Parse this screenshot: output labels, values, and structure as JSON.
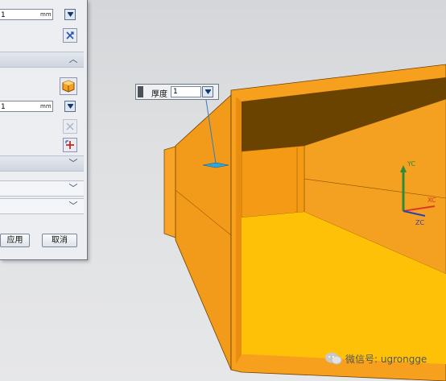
{
  "dialog": {
    "value1": "1",
    "unit1": "mm",
    "value2": "1",
    "unit2": "mm",
    "apply_label": "应用",
    "cancel_label": "取消"
  },
  "thickness_handle": {
    "label": "厚度",
    "value": "1"
  },
  "axes": {
    "y_label": "YC",
    "x_label": "XC",
    "z_label": "ZC"
  },
  "watermark": {
    "text": "微信号: ugrongge"
  },
  "colors": {
    "model_orange": "#f39a1c",
    "model_dark": "#6b4300",
    "floor_yellow": "#ffc000",
    "panel_bg": "#eceef1"
  },
  "icons": [
    "chevron-down-icon",
    "chevron-up-icon",
    "cube-icon",
    "swap-direction-icon",
    "reverse-add-icon",
    "wechat-icon"
  ]
}
